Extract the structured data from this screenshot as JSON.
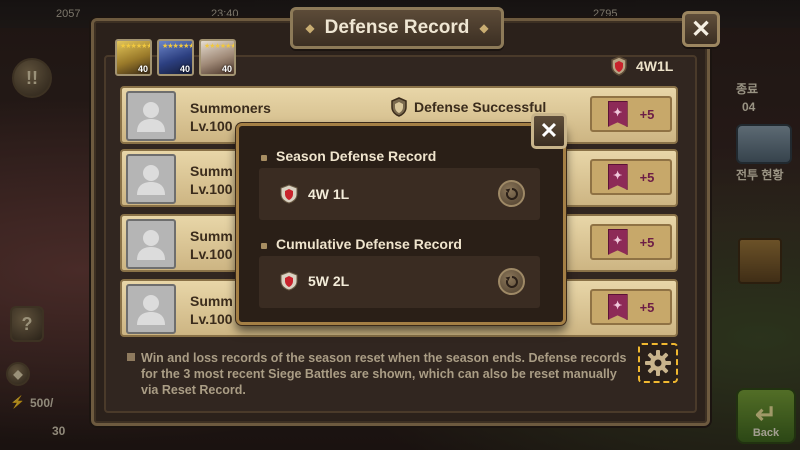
{
  "background": {
    "topbar": {
      "left_value": "2057",
      "time": "23:40",
      "right_value": "2795"
    },
    "left": {
      "quest_icon": "!!",
      "help_icon": "?",
      "energy": "500/",
      "bottom_value": "30"
    },
    "right": {
      "end_label": "종료",
      "timer_suffix": "04",
      "battle_status_label": "전투 현황",
      "back_label": "Back"
    }
  },
  "window": {
    "title": "Defense Record",
    "record_summary": "4W1L",
    "monsters": [
      {
        "icon": "sports-car-monster",
        "level": "40",
        "stars": "★★★★★★"
      },
      {
        "icon": "blue-dragon-monster",
        "level": "40",
        "stars": "★★★★★★"
      },
      {
        "icon": "white-hair-monster",
        "level": "40",
        "stars": "★★★★★★"
      }
    ],
    "rows": [
      {
        "name": "Summoners",
        "level": "Lv.100 ",
        "result": "Defense Successful",
        "reward": "+5"
      },
      {
        "name": "Summ",
        "level": "Lv.100",
        "result": "",
        "reward": "+5"
      },
      {
        "name": "Summ",
        "level": "Lv.100",
        "result": "",
        "reward": "+5"
      },
      {
        "name": "Summ",
        "level": "Lv.100",
        "result": "",
        "reward": "+5"
      }
    ],
    "footer_note": "Win and loss records of the season reset when the season ends. Defense records for the 3 most recent Siege Battles are shown, which can also be reset manually via Reset Record."
  },
  "popup": {
    "season": {
      "title": "Season Defense Record",
      "value": "4W 1L"
    },
    "cumulative": {
      "title": "Cumulative Defense Record",
      "value": "5W 2L"
    }
  },
  "colors": {
    "accent_gold": "#f0b830",
    "reward_text": "#6d1d46",
    "row_bg": "#e2cd9b",
    "shield_red": "#c8232c"
  }
}
